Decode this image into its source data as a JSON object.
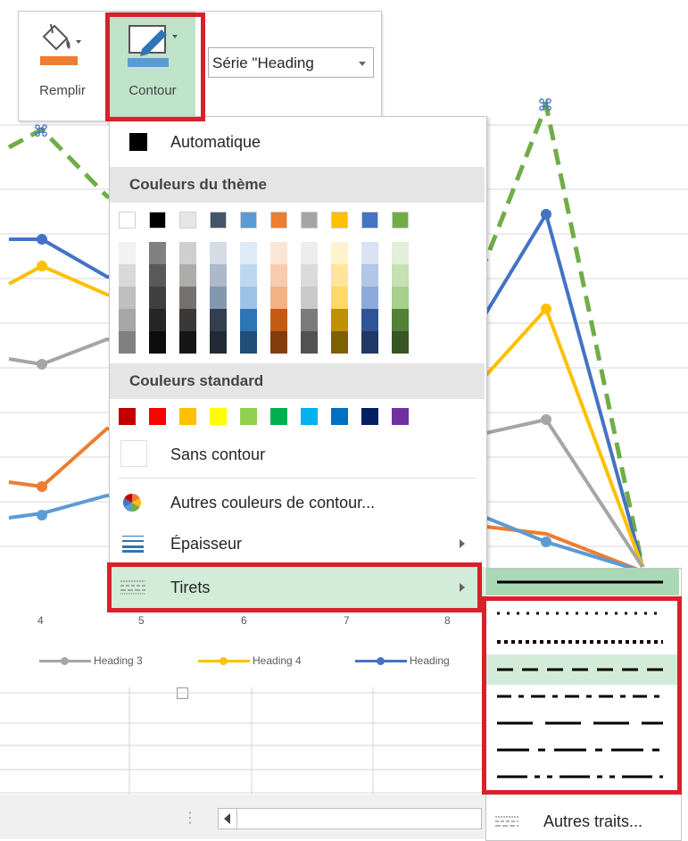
{
  "ribbon": {
    "fill_label": "Remplir",
    "outline_label": "Contour",
    "series_select": "Série \"Heading"
  },
  "chart": {
    "x_ticks": [
      "4",
      "5",
      "6",
      "7",
      "8"
    ],
    "legend": [
      "Heading 3",
      "Heading 4",
      "Heading"
    ]
  },
  "outline_menu": {
    "automatic": "Automatique",
    "theme_colors_header": "Couleurs du thème",
    "standard_colors_header": "Couleurs standard",
    "no_outline": "Sans contour",
    "more_colors": "Autres couleurs de contour...",
    "weight": "Épaisseur",
    "dashes": "Tirets",
    "theme_colors": [
      "#FFFFFF",
      "#000000",
      "#E7E6E6",
      "#44546A",
      "#5B9BD5",
      "#ED7D31",
      "#A5A5A5",
      "#FFC000",
      "#4472C4",
      "#70AD47"
    ],
    "standard_colors": [
      "#C00000",
      "#FF0000",
      "#FFC000",
      "#FFFF00",
      "#92D050",
      "#00B050",
      "#00B0F0",
      "#0070C0",
      "#002060",
      "#7030A0"
    ]
  },
  "dash_submenu": {
    "more_lines": "Autres traits..."
  }
}
